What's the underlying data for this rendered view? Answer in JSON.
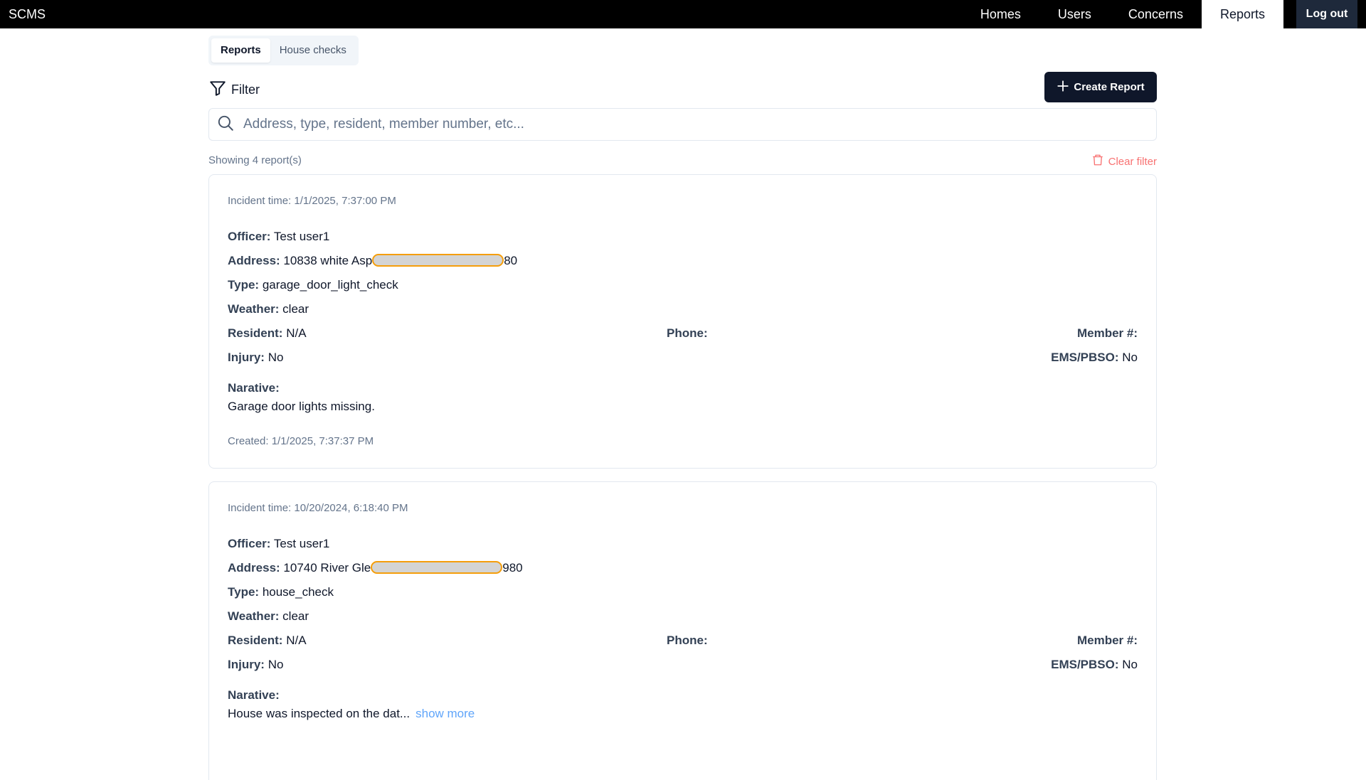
{
  "app": {
    "brand": "SCMS"
  },
  "nav": {
    "items": [
      {
        "label": "Homes"
      },
      {
        "label": "Users"
      },
      {
        "label": "Concerns"
      },
      {
        "label": "Reports",
        "active": true
      }
    ],
    "logout_label": "Log out"
  },
  "tabs": [
    {
      "label": "Reports",
      "active": true
    },
    {
      "label": "House checks"
    }
  ],
  "toolbar": {
    "filter_label": "Filter",
    "create_label": "Create Report",
    "search_placeholder": "Address, type, resident, member number, etc..."
  },
  "results": {
    "showing_text": "Showing 4 report(s)",
    "clear_label": "Clear filter"
  },
  "labels": {
    "officer": "Officer:",
    "address": "Address:",
    "type": "Type:",
    "weather": "Weather:",
    "resident": "Resident:",
    "phone": "Phone:",
    "member": "Member #:",
    "injury": "Injury:",
    "ems": "EMS/PBSO:",
    "narrative": "Narative:",
    "show_more": "show more"
  },
  "reports": [
    {
      "incident_time": "Incident time: 1/1/2025, 7:37:00 PM",
      "officer": "Test user1",
      "address_start": "10838 white Asp",
      "address_end": "80",
      "type": "garage_door_light_check",
      "weather": "clear",
      "resident": "N/A",
      "phone": "",
      "member": "",
      "injury": "No",
      "ems": "No",
      "narrative": "Garage door lights missing.",
      "created": "Created: 1/1/2025, 7:37:37 PM"
    },
    {
      "incident_time": "Incident time: 10/20/2024, 6:18:40 PM",
      "officer": "Test user1",
      "address_start": "10740 River Gle",
      "address_end": "980",
      "type": "house_check",
      "weather": "clear",
      "resident": "N/A",
      "phone": "",
      "member": "",
      "injury": "No",
      "ems": "No",
      "narrative": "House was inspected on the dat..."
    }
  ]
}
